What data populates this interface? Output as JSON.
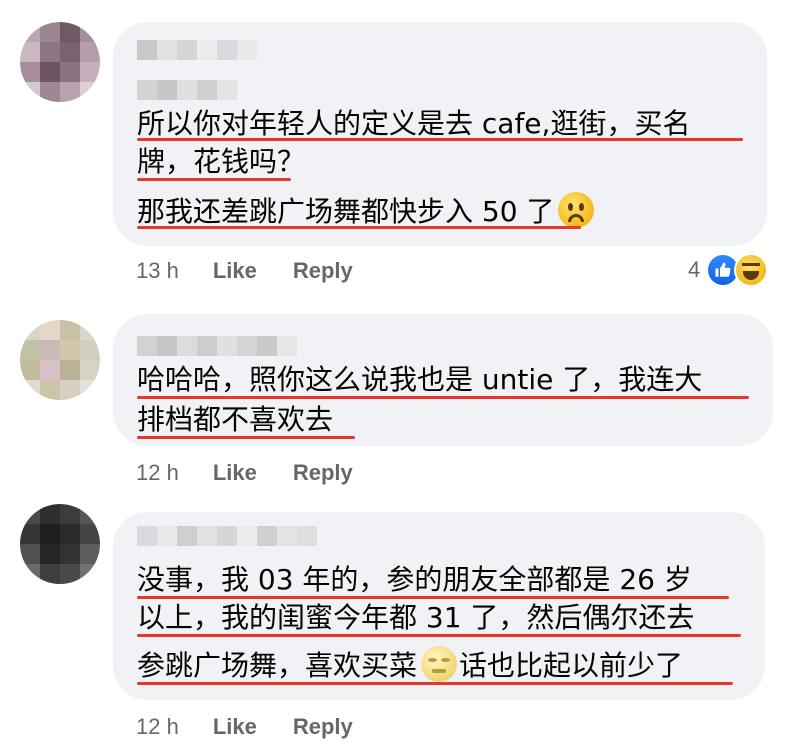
{
  "comments": [
    {
      "lines": [
        "所以你对年轻人的定义是去 cafe,逛街，买名",
        "牌，花钱吗？",
        "那我还差跳广场舞都快步入 50 了"
      ],
      "emoji": "frowning-face",
      "time": "13 h",
      "like_label": "Like",
      "reply_label": "Reply",
      "reaction_count": "4",
      "reactions": [
        "like-icon",
        "haha-icon"
      ]
    },
    {
      "lines": [
        "哈哈哈，照你这么说我也是 untie 了，我连大",
        "排档都不喜欢去"
      ],
      "time": "12 h",
      "like_label": "Like",
      "reply_label": "Reply"
    },
    {
      "lines": [
        "没事，我 03 年的，参的朋友全部都是 26 岁",
        "以上，我的闺蜜今年都 31 了，然后偶尔还去",
        "参跳广场舞，喜欢买菜",
        "话也比起以前少了"
      ],
      "emoji": "moon-face",
      "time": "12 h",
      "like_label": "Like",
      "reply_label": "Reply"
    }
  ],
  "colors": {
    "bubble": "#f0f2f5",
    "underline": "#e5392d",
    "meta": "#65676b",
    "like_blue": "#1877f2"
  }
}
